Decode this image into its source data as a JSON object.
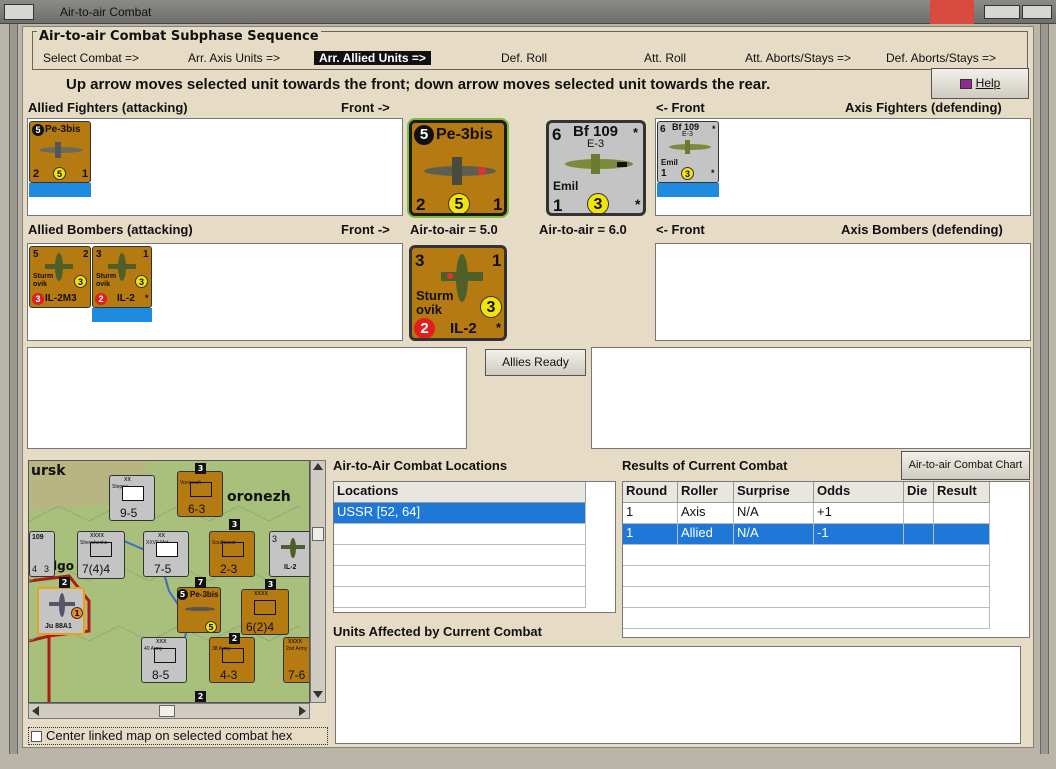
{
  "window": {
    "title": "Air-to-air Combat"
  },
  "subphase": {
    "header": "Air-to-air Combat Subphase Sequence",
    "steps": [
      "Select Combat =>",
      "Arr. Axis Units =>",
      "Arr. Allied Units =>",
      "Def. Roll",
      "Att. Roll",
      "Att. Aborts/Stays =>",
      "Def. Aborts/Stays =>"
    ],
    "active_step": "Arr. Allied Units =>"
  },
  "instruction": "Up arrow moves selected unit towards the front; down arrow moves selected unit towards the rear.",
  "help_button": "Help",
  "labels": {
    "allied_fighters": "Allied Fighters (attacking)",
    "front_right": "Front ->",
    "front_left": "<- Front",
    "axis_fighters": "Axis Fighters (defending)",
    "allied_bombers": "Allied Bombers (attacking)",
    "front_right2": "Front ->",
    "allied_air": "Air-to-air = 5.0",
    "axis_air": "Air-to-air = 6.0",
    "front_left2": "<- Front",
    "axis_bombers": "Axis Bombers (defending)",
    "allies_ready": "Allies Ready",
    "locations_title": "Air-to-Air Combat Locations",
    "results_title": "Results of Current Combat",
    "chart_button": "Air-to-air Combat Chart",
    "units_affected": "Units Affected by Current Combat",
    "center_map": "Center linked map on selected combat hex"
  },
  "counters": {
    "pe3bis": {
      "name": "Pe-3bis",
      "top_left": "5",
      "bottom_left": "2",
      "mid": "5",
      "bottom_right": "1"
    },
    "bf109": {
      "name": "Bf 109",
      "sub": "E-3",
      "top_left": "6",
      "star": "*",
      "nick": "Emil",
      "bottom_left": "1",
      "mid": "3",
      "bottom_right": "*"
    },
    "il2m3": {
      "name": "IL-2M3",
      "top_left": "5",
      "top_right": "2",
      "mid": "3",
      "red": "3",
      "nick1": "Sturm",
      "nick2": "ovik"
    },
    "il2": {
      "name": "IL-2",
      "top_left": "3",
      "top_right": "1",
      "mid": "3",
      "red": "2",
      "star": "*",
      "nick1": "Sturm",
      "nick2": "ovik"
    }
  },
  "map": {
    "towns": [
      "ursk",
      "oronezh",
      "lgo"
    ],
    "units": [
      "9-5",
      "6-3",
      "7(4)4",
      "7-5",
      "2-3",
      "8-5",
      "4-3",
      "6(2)4",
      "7-6",
      "Pe-3bis",
      "Ju 88A1"
    ],
    "sizes": [
      "xxxx",
      "xx",
      "xxx",
      "xxxx",
      "xxxx",
      "xx",
      "xxxx"
    ],
    "side_labels": [
      "Steppe",
      "Voronezh",
      "Shevchenko",
      "Southwest",
      "XXVII Mot",
      "40 Army",
      "38 Army",
      "2nd Army"
    ],
    "stack_counts": [
      "3",
      "3",
      "3",
      "2",
      "7",
      "5",
      "2",
      "2"
    ],
    "counter_marks": [
      "109",
      "4",
      "3",
      "IL-2",
      "5",
      "3",
      "1"
    ]
  },
  "locations": {
    "header": "Locations",
    "rows": [
      "USSR [52, 64]"
    ]
  },
  "results": {
    "headers": [
      "Round",
      "Roller",
      "Surprise",
      "Odds",
      "Die",
      "Result"
    ],
    "rows": [
      [
        "1",
        "Axis",
        "N/A",
        "+1",
        "",
        ""
      ],
      [
        "1",
        "Allied",
        "N/A",
        "-1",
        "",
        ""
      ]
    ]
  },
  "colors": {
    "selection": "#1f78d7",
    "allied_counter": "#b67a12",
    "axis_counter": "#c4c4c4",
    "dialog_bg": "#e6dcc6"
  }
}
